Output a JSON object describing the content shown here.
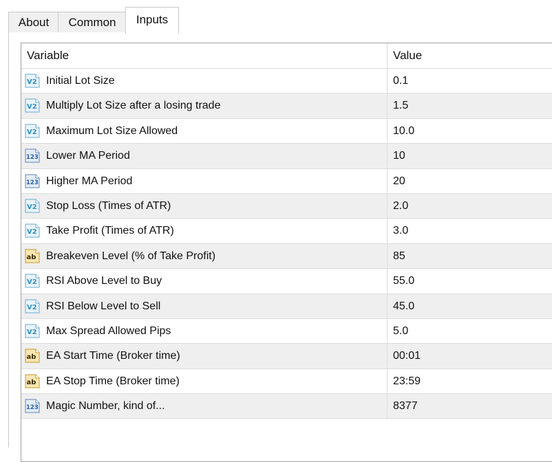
{
  "tabs": [
    {
      "label": "About"
    },
    {
      "label": "Common"
    },
    {
      "label": "Inputs",
      "active": true
    }
  ],
  "table": {
    "headers": {
      "variable": "Variable",
      "value": "Value"
    },
    "rows": [
      {
        "icon": "double-type-icon",
        "name": "Initial Lot Size",
        "value": "0.1"
      },
      {
        "icon": "double-type-icon",
        "name": "Multiply Lot Size after a losing trade",
        "value": "1.5"
      },
      {
        "icon": "double-type-icon",
        "name": "Maximum Lot Size Allowed",
        "value": "10.0"
      },
      {
        "icon": "integer-type-icon",
        "name": "Lower MA Period",
        "value": "10"
      },
      {
        "icon": "integer-type-icon",
        "name": "Higher MA Period",
        "value": "20"
      },
      {
        "icon": "double-type-icon",
        "name": "Stop Loss (Times of ATR)",
        "value": "2.0"
      },
      {
        "icon": "double-type-icon",
        "name": "Take Profit (Times of ATR)",
        "value": "3.0"
      },
      {
        "icon": "string-type-icon",
        "name": "Breakeven Level (% of Take Profit)",
        "value": "85"
      },
      {
        "icon": "double-type-icon",
        "name": "RSI Above Level to Buy",
        "value": "55.0"
      },
      {
        "icon": "double-type-icon",
        "name": "RSI Below Level to Sell",
        "value": "45.0"
      },
      {
        "icon": "double-type-icon",
        "name": "Max Spread Allowed Pips",
        "value": "5.0"
      },
      {
        "icon": "string-type-icon",
        "name": "EA Start Time (Broker time)",
        "value": "00:01"
      },
      {
        "icon": "string-type-icon",
        "name": "EA Stop Time (Broker time)",
        "value": "23:59"
      },
      {
        "icon": "integer-type-icon",
        "name": "Magic Number, kind of...",
        "value": "8377"
      }
    ]
  },
  "colors": {
    "row_alt": "#efefef",
    "grid_border": "#a0a0a0",
    "double_icon": "#2f8fc7",
    "integer_icon": "#2a5fa8",
    "string_icon": "#d9a21c"
  }
}
